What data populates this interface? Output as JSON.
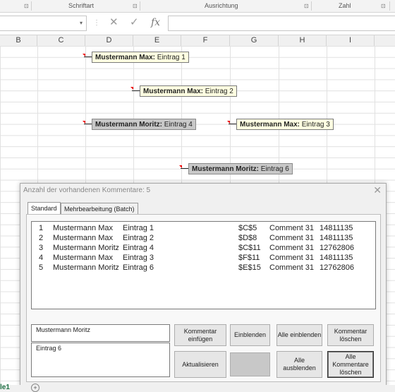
{
  "ribbon": {
    "groups": [
      "Schriftart",
      "Ausrichtung",
      "Zahl"
    ]
  },
  "formula_bar": {
    "fx_label": "fx",
    "cancel_icon": "x-icon",
    "enter_icon": "check-icon"
  },
  "columns": [
    "B",
    "C",
    "D",
    "E",
    "F",
    "G",
    "H",
    "I"
  ],
  "comments": [
    {
      "author": "Mustermann Max:",
      "text": " Eintrag 1",
      "style": "yellow"
    },
    {
      "author": "Mustermann Max:",
      "text": " Eintrag 2",
      "style": "yellow"
    },
    {
      "author": "Mustermann Moritz:",
      "text": " Eintrag 4",
      "style": "gray"
    },
    {
      "author": "Mustermann Max:",
      "text": " Eintrag 3",
      "style": "yellow"
    },
    {
      "author": "Mustermann Moritz:",
      "text": " Eintrag 6",
      "style": "gray"
    }
  ],
  "dialog": {
    "title": "Anzahl der vorhandenen Kommentare: 5",
    "close": "✕",
    "tabs": [
      "Standard",
      "Mehrbearbeitung (Batch)"
    ],
    "rows": [
      [
        "1",
        "Mustermann Max",
        "Eintrag 1",
        "$C$5",
        "Comment 31",
        "14811135"
      ],
      [
        "2",
        "Mustermann Max",
        "Eintrag 2",
        "$D$8",
        "Comment 31",
        "14811135"
      ],
      [
        "3",
        "Mustermann Moritz",
        "Eintrag 4",
        "$C$11",
        "Comment 31",
        "12762806"
      ],
      [
        "4",
        "Mustermann Max",
        "Eintrag 3",
        "$F$11",
        "Comment 31",
        "14811135"
      ],
      [
        "5",
        "Mustermann Moritz",
        "Eintrag 6",
        "$E$15",
        "Comment 31",
        "12762806"
      ]
    ],
    "author_field": "Mustermann Moritz",
    "text_field": "Eintrag 6",
    "buttons": {
      "insert": "Kommentar einfügen",
      "show": "Einblenden",
      "show_all": "Alle einblenden",
      "delete": "Kommentar löschen",
      "refresh": "Aktualisieren",
      "hide_all": "Alle ausblenden",
      "delete_all": "Alle Kommentare löschen"
    }
  },
  "sheet_tab": {
    "label": "le1",
    "add": "+"
  }
}
